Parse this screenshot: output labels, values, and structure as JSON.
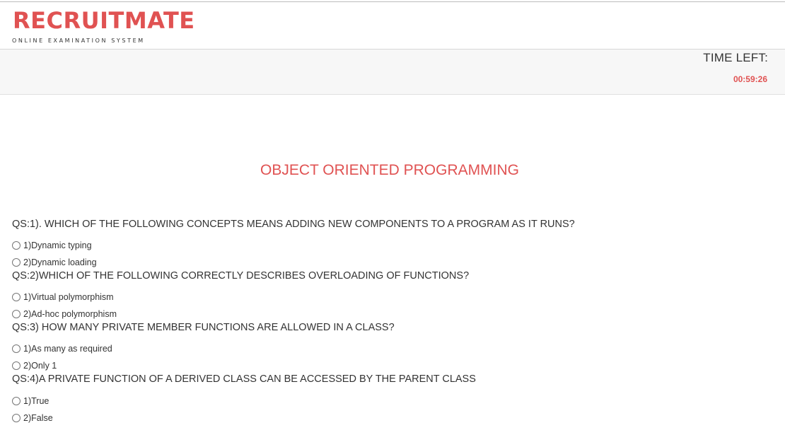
{
  "brand": {
    "title": "RECRUITMATE",
    "subtitle": "ONLINE EXAMINATION SYSTEM",
    "accent_color": "#e05252"
  },
  "timer": {
    "label": "TIME LEFT:",
    "value": "00:59:26"
  },
  "subject": {
    "title": "OBJECT ORIENTED PROGRAMMING"
  },
  "questions": [
    {
      "text": "QS:1). WHICH OF THE FOLLOWING CONCEPTS MEANS ADDING NEW COMPONENTS TO A PROGRAM AS IT RUNS?",
      "options": [
        "1)Dynamic typing",
        "2)Dynamic loading"
      ]
    },
    {
      "text": "QS:2)WHICH OF THE FOLLOWING CORRECTLY DESCRIBES OVERLOADING OF FUNCTIONS?",
      "options": [
        "1)Virtual polymorphism",
        "2)Ad-hoc polymorphism"
      ]
    },
    {
      "text": "QS:3) HOW MANY PRIVATE MEMBER FUNCTIONS ARE ALLOWED IN A CLASS?",
      "options": [
        "1)As many as required",
        "2)Only 1"
      ]
    },
    {
      "text": "QS:4)A PRIVATE FUNCTION OF A DERIVED CLASS CAN BE ACCESSED BY THE PARENT CLASS",
      "options": [
        "1)True",
        "2)False"
      ]
    }
  ]
}
